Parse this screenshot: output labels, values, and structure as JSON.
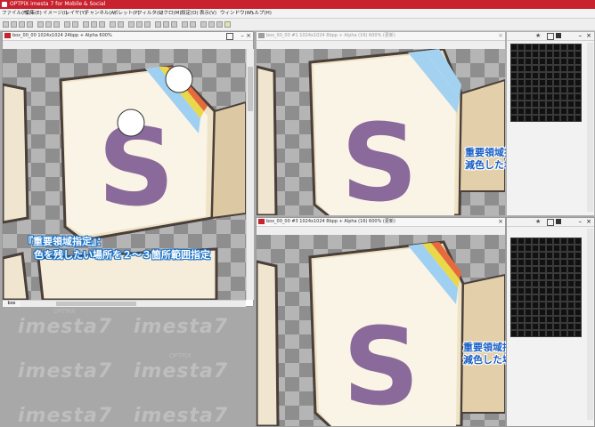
{
  "app": {
    "title": "OPTPiX imesta 7 for Mobile & Social"
  },
  "menu": [
    "ファイル(F)",
    "編集(E)",
    "イメージ(I)",
    "レイヤ(Y)",
    "チャンネル(A)",
    "パレット(P)",
    "フィルタ(L)",
    "マクロ(M)",
    "設定(O)",
    "表示(V)",
    "ウィンドウ(W)",
    "ヘルプ(H)"
  ],
  "windows": {
    "left": {
      "title": "box_00_00  1024x1024  24bpp + Alpha  600%",
      "tab": "box"
    },
    "top_right": {
      "title": "box_00_00 #1  1024x1024  8bpp + Alpha (16)  600%  (更新)"
    },
    "bottom_right": {
      "title": "box_00_00 #3  1024x1024  8bpp + Alpha (16)  600%  (更新)"
    }
  },
  "captions": {
    "left_line1": "『重要領域指定』：",
    "left_line2": "色を残したい場所を２～３箇所範囲指定",
    "top_right_line1": "重要領域指定せずに",
    "top_right_line2": "減色した場合",
    "bottom_right_line1": "重要領域指定してから",
    "bottom_right_line2": "減色した場合"
  },
  "image": {
    "glyph": "S"
  },
  "watermark": {
    "text": "imesta7",
    "sub": "OPTPiX"
  },
  "colors": {
    "titlebar": "#c8222e",
    "caption_blue": "#1a73c9",
    "s_purple": "#8a6a9a",
    "box_cream": "#f7efe0"
  }
}
